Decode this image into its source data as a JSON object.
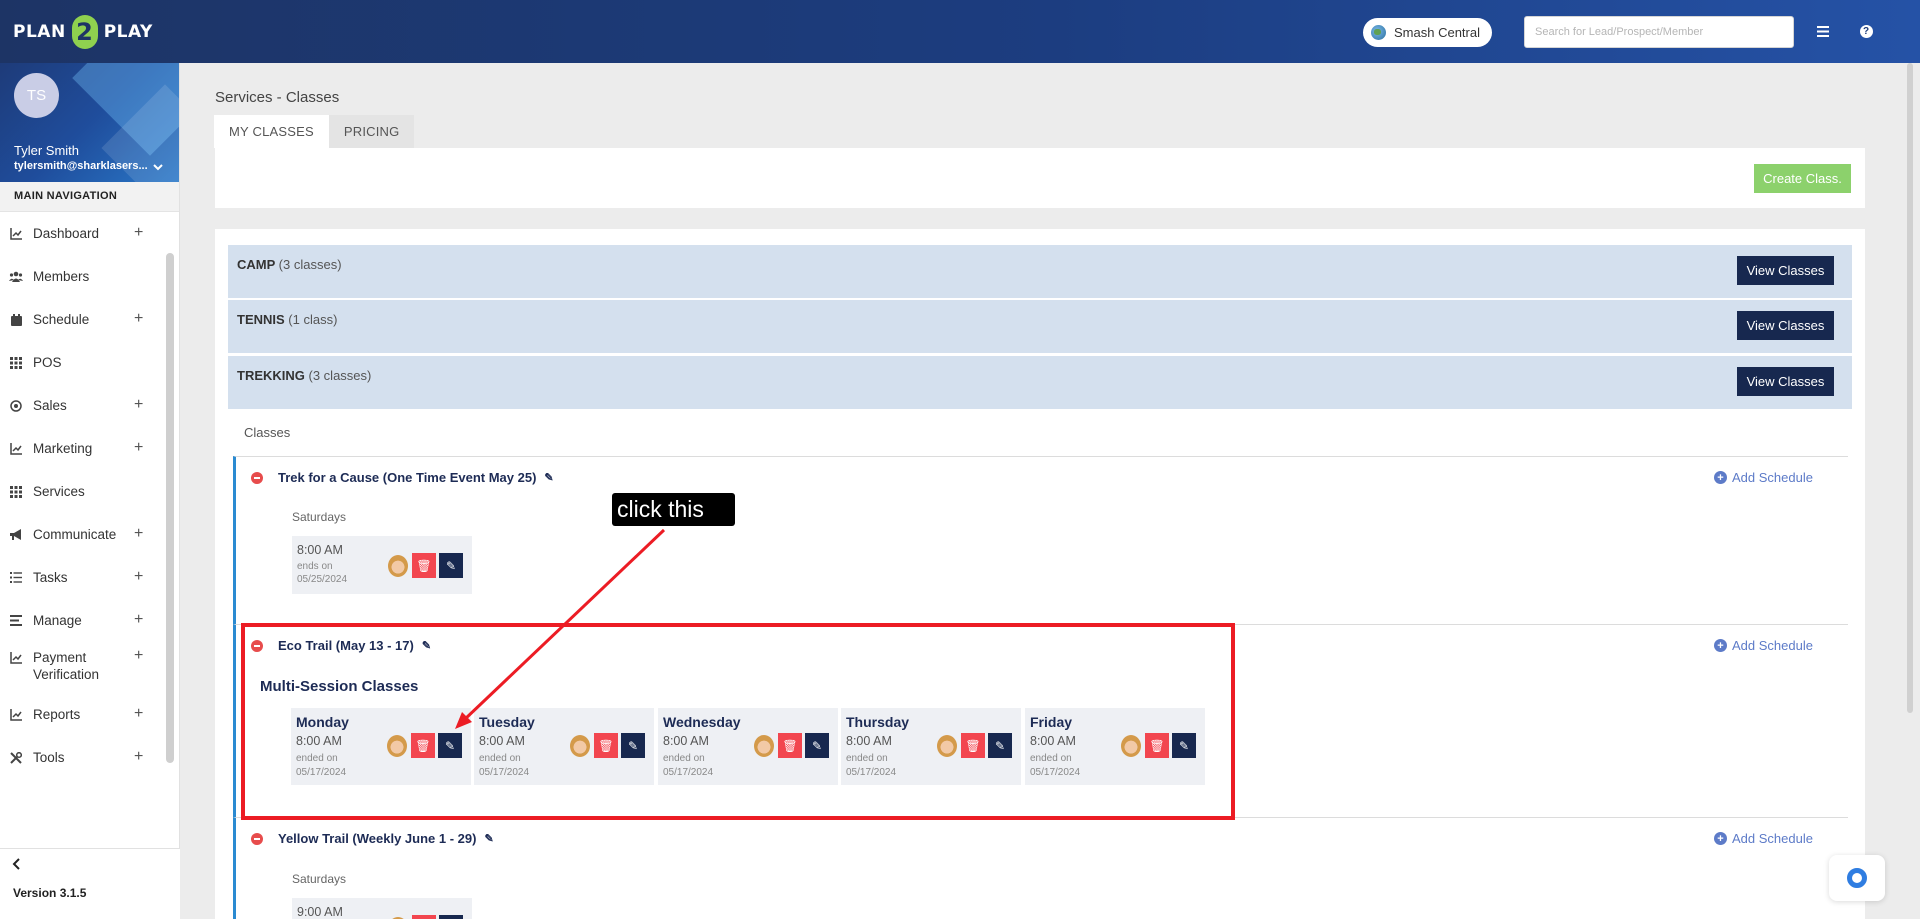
{
  "header": {
    "logo_left": "PLAN",
    "logo_mid": "2",
    "logo_right": "PLAY",
    "location": "Smash Central",
    "search_placeholder": "Search for Lead/Prospect/Member",
    "menu_icon": "hamburger-icon",
    "help_icon": "question-icon"
  },
  "sidebar": {
    "avatar_initials": "TS",
    "user_name": "Tyler Smith",
    "user_email": "tylersmith@sharklasers...",
    "nav_heading": "MAIN NAVIGATION",
    "items": [
      {
        "label": "Dashboard",
        "icon": "chart-icon",
        "expandable": "+"
      },
      {
        "label": "Members",
        "icon": "users-icon",
        "expandable": ""
      },
      {
        "label": "Schedule",
        "icon": "calendar-icon",
        "expandable": "+"
      },
      {
        "label": "POS",
        "icon": "grid-icon",
        "expandable": ""
      },
      {
        "label": "Sales",
        "icon": "target-icon",
        "expandable": "+"
      },
      {
        "label": "Marketing",
        "icon": "line-chart-icon",
        "expandable": "+"
      },
      {
        "label": "Services",
        "icon": "grid-icon",
        "expandable": ""
      },
      {
        "label": "Communicate",
        "icon": "megaphone-icon",
        "expandable": "+"
      },
      {
        "label": "Tasks",
        "icon": "list-icon",
        "expandable": "+"
      },
      {
        "label": "Manage",
        "icon": "bars-icon",
        "expandable": "+"
      },
      {
        "label": "Payment Verification",
        "icon": "line-chart-icon",
        "expandable": "+"
      },
      {
        "label": "Reports",
        "icon": "line-chart-icon",
        "expandable": "+"
      },
      {
        "label": "Tools",
        "icon": "tools-icon",
        "expandable": "+"
      }
    ],
    "version": "Version 3.1.5"
  },
  "main": {
    "page_title": "Services - Classes",
    "tabs": [
      {
        "label": "MY CLASSES",
        "active": true
      },
      {
        "label": "PRICING",
        "active": false
      }
    ],
    "create_button": "Create Class.",
    "categories": [
      {
        "name": "CAMP",
        "count": "(3 classes)",
        "button": "View Classes"
      },
      {
        "name": "TENNIS",
        "count": "(1 class)",
        "button": "View Classes"
      },
      {
        "name": "TREKKING",
        "count": "(3 classes)",
        "button": "View Classes"
      }
    ],
    "classes_label": "Classes",
    "add_schedule": "Add Schedule",
    "classes": [
      {
        "title": "Trek for a Cause (One Time Event May 25)",
        "day": "Saturdays",
        "time": "8:00 AM",
        "ends_label": "ends on",
        "ends_date": "05/25/2024"
      },
      {
        "title": "Eco Trail (May 13 - 17)",
        "multi_title": "Multi-Session Classes",
        "sessions": [
          {
            "day": "Monday",
            "time": "8:00 AM",
            "ends_label": "ended on",
            "ends_date": "05/17/2024"
          },
          {
            "day": "Tuesday",
            "time": "8:00 AM",
            "ends_label": "ended on",
            "ends_date": "05/17/2024"
          },
          {
            "day": "Wednesday",
            "time": "8:00 AM",
            "ends_label": "ended on",
            "ends_date": "05/17/2024"
          },
          {
            "day": "Thursday",
            "time": "8:00 AM",
            "ends_label": "ended on",
            "ends_date": "05/17/2024"
          },
          {
            "day": "Friday",
            "time": "8:00 AM",
            "ends_label": "ended on",
            "ends_date": "05/17/2024"
          }
        ]
      },
      {
        "title": "Yellow Trail (Weekly June 1 - 29)",
        "day": "Saturdays",
        "time": "9:00 AM"
      }
    ]
  },
  "annotation": {
    "callout_text": "click this",
    "highlight_color": "#ec1c24"
  }
}
